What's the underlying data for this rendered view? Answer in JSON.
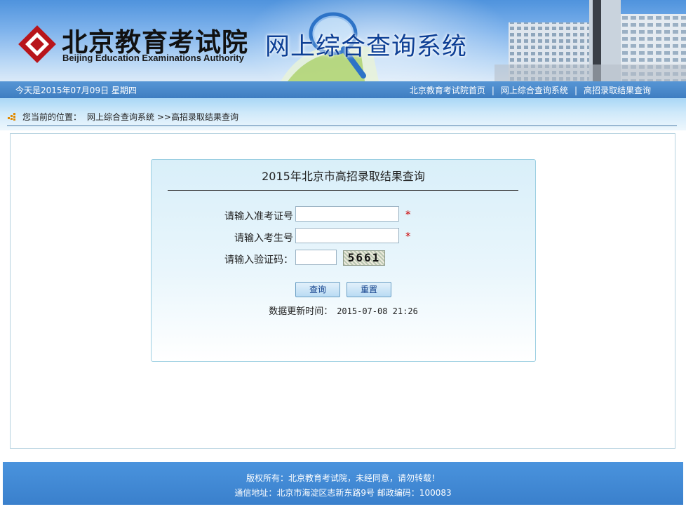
{
  "banner": {
    "logo_cn": "北京教育考试院",
    "logo_en": "Beijing Education Examinations Authority",
    "system_title": "网上综合查询系统"
  },
  "topbar": {
    "date": "今天是2015年07月09日 星期四",
    "nav": [
      {
        "label": "北京教育考试院首页"
      },
      {
        "label": "网上综合查询系统"
      },
      {
        "label": "高招录取结果查询"
      }
    ],
    "separator": "|"
  },
  "breadcrumb": {
    "prefix": "您当前的位置：",
    "path": "网上综合查询系统 >>高招录取结果查询"
  },
  "query": {
    "title": "2015年北京市高招录取结果查询",
    "exam_label": "请输入准考证号",
    "exam_value": "",
    "student_label": "请输入考生号",
    "student_value": "",
    "captcha_label": "请输入验证码：",
    "captcha_value": "",
    "captcha_text": "5661",
    "required_mark": "*",
    "query_button": "查询",
    "reset_button": "重置",
    "update_label": "数据更新时间：",
    "update_value": "2015-07-08 21:26"
  },
  "footer": {
    "line1": "版权所有：北京教育考试院，未经同意，请勿转载！",
    "line2": "通信地址：北京市海淀区志新东路9号 邮政编码：100083"
  },
  "colors": {
    "accent_blue": "#3e7dc1",
    "title_blue": "#0d3f95",
    "required_red": "#cc0000",
    "footer_blue": "#4a93dd"
  },
  "icons": [
    "logo-emblem-icon",
    "breadcrumb-grid-icon"
  ]
}
